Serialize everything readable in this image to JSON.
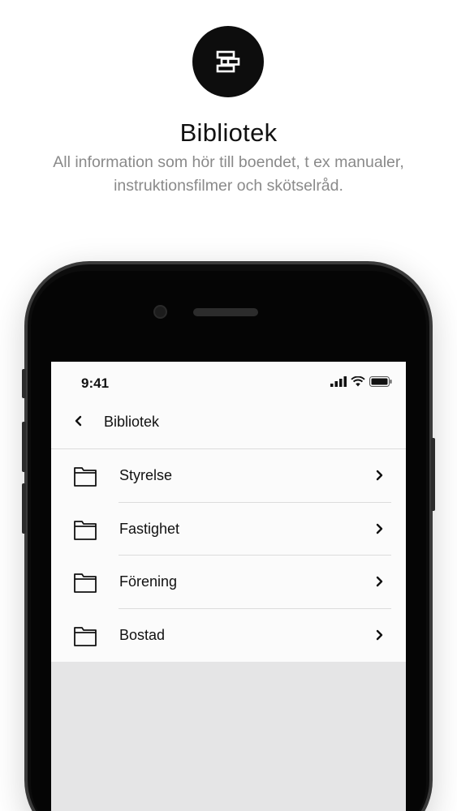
{
  "hero": {
    "icon": "library-icon",
    "title": "Bibliotek",
    "subtitle": "All information som hör till boendet, t ex manualer, instruktionsfilmer och skötselråd."
  },
  "status_bar": {
    "time": "9:41",
    "icons": [
      "signal-icon",
      "wifi-icon",
      "battery-icon"
    ]
  },
  "nav": {
    "back_icon": "chevron-left-icon",
    "title": "Bibliotek"
  },
  "list": {
    "items": [
      {
        "label": "Styrelse",
        "icon": "folder-icon"
      },
      {
        "label": "Fastighet",
        "icon": "folder-icon"
      },
      {
        "label": "Förening",
        "icon": "folder-icon"
      },
      {
        "label": "Bostad",
        "icon": "folder-icon"
      }
    ]
  },
  "colors": {
    "hero_circle": "#0d0d0d",
    "subtitle": "#8a8a8a",
    "screen_bg": "#e5e5e6"
  }
}
